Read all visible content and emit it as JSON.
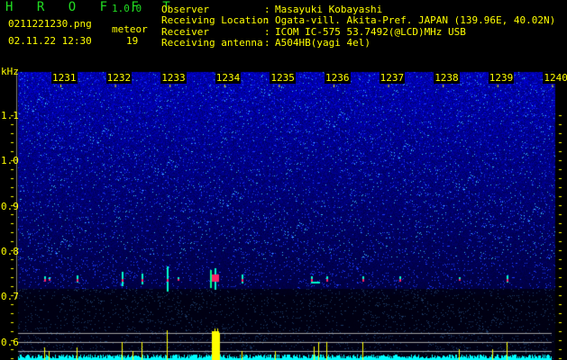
{
  "app": {
    "name": "H R O F F T",
    "version": "1.0.0"
  },
  "file": {
    "name": "0211221230.png",
    "datetime": "02.11.22 12:30"
  },
  "meteor": {
    "label": "meteor",
    "count": "19"
  },
  "info": [
    {
      "label": "Observer",
      "value": "Masayuki Kobayashi"
    },
    {
      "label": "Receiving Location",
      "value": "Ogata-vill. Akita-Pref. JAPAN (139.96E, 40.02N)"
    },
    {
      "label": "Receiver",
      "value": "ICOM IC-575 53.7492(@LCD)MHz USB"
    },
    {
      "label": "Receiving antenna",
      "value": "A504HB(yagi 4el)"
    }
  ],
  "colon": ":",
  "axis": {
    "unit": "kHz",
    "y_ticks": [
      "1.1",
      "1.0",
      "0.9",
      "0.8",
      "0.7",
      "0.6"
    ],
    "time_ticks": [
      "1231",
      "1232",
      "1233",
      "1234",
      "1235",
      "1236",
      "1237",
      "1238",
      "1239",
      "1240"
    ]
  },
  "colors": {
    "text": "#ffff00",
    "title": "#22dd22",
    "histogram": "#00ffff",
    "spike": "#ffff00"
  }
}
